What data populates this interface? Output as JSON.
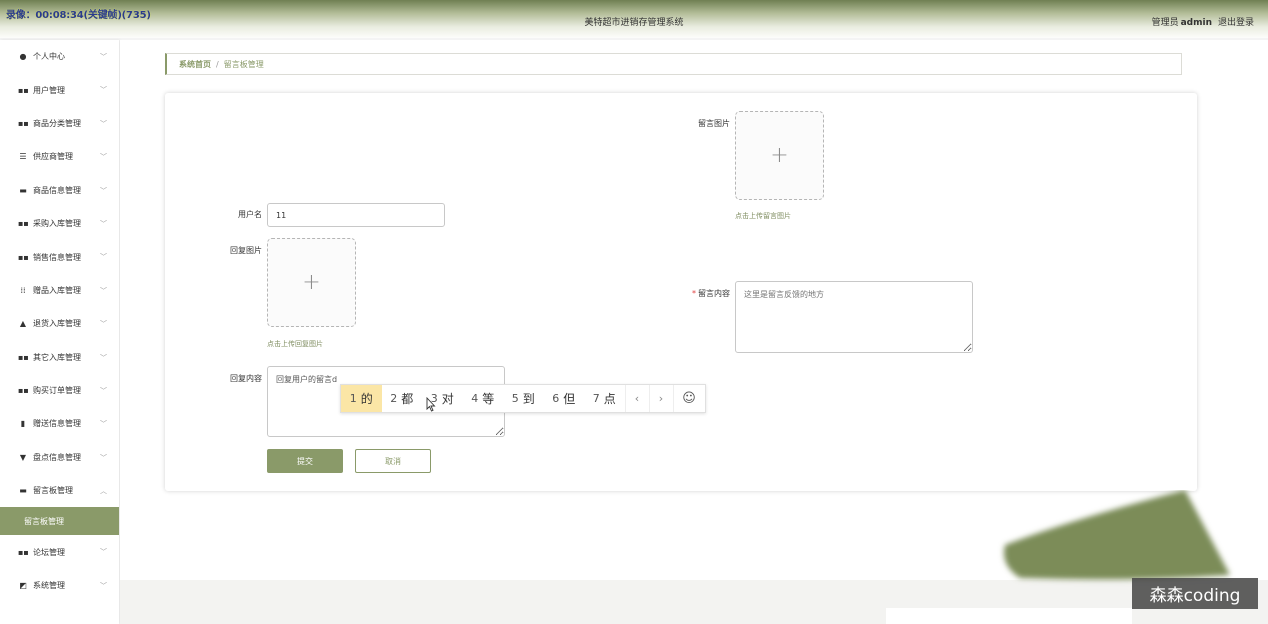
{
  "recording_overlay": "录像：00:08:34(关键帧)(735)",
  "header": {
    "title": "美特超市进销存管理系统",
    "role": "管理员",
    "username": "admin",
    "logout": "退出登录"
  },
  "sidebar": {
    "items": [
      {
        "label": "个人中心",
        "icon": "person-icon"
      },
      {
        "label": "用户管理",
        "icon": "grid-icon"
      },
      {
        "label": "商品分类管理",
        "icon": "grid-icon"
      },
      {
        "label": "供应商管理",
        "icon": "list-icon"
      },
      {
        "label": "商品信息管理",
        "icon": "chat-icon"
      },
      {
        "label": "采购入库管理",
        "icon": "grid-icon"
      },
      {
        "label": "销售信息管理",
        "icon": "grid-icon"
      },
      {
        "label": "赠品入库管理",
        "icon": "apps-icon"
      },
      {
        "label": "退货入库管理",
        "icon": "thumb-icon"
      },
      {
        "label": "其它入库管理",
        "icon": "grid-icon"
      },
      {
        "label": "购买订单管理",
        "icon": "grid-icon"
      },
      {
        "label": "赠送信息管理",
        "icon": "clipboard-icon"
      },
      {
        "label": "盘点信息管理",
        "icon": "trophy-icon"
      },
      {
        "label": "留言板管理",
        "icon": "board-icon"
      }
    ],
    "active_submenu": "留言板管理",
    "bottom_items": [
      {
        "label": "论坛管理",
        "icon": "grid-icon"
      },
      {
        "label": "系统管理",
        "icon": "chart-icon"
      }
    ]
  },
  "breadcrumb": {
    "home": "系统首页",
    "separator": "/",
    "current": "留言板管理"
  },
  "form": {
    "username_label": "用户名",
    "username_value": "11",
    "reply_image_label": "回复图片",
    "reply_image_hint": "点击上传回复图片",
    "reply_content_label": "回复内容",
    "reply_content_value": "回复用户的留言d",
    "message_image_label": "留言图片",
    "message_image_hint": "点击上传留言图片",
    "message_content_label": "留言内容",
    "message_content_required": "*",
    "message_content_placeholder": "这里是留言反馈的地方",
    "submit_label": "提交",
    "cancel_label": "取消"
  },
  "ime": {
    "candidates": [
      {
        "num": "1",
        "char": "的"
      },
      {
        "num": "2",
        "char": "都"
      },
      {
        "num": "3",
        "char": "对"
      },
      {
        "num": "4",
        "char": "等"
      },
      {
        "num": "5",
        "char": "到"
      },
      {
        "num": "6",
        "char": "但"
      },
      {
        "num": "7",
        "char": "点"
      }
    ],
    "prev": "‹",
    "next": "›",
    "emoji": "☺"
  },
  "watermark": "森森coding",
  "colors": {
    "accent": "#8a9a69",
    "header_dark": "#6f7f52",
    "ime_highlight": "#fbe6a6"
  }
}
